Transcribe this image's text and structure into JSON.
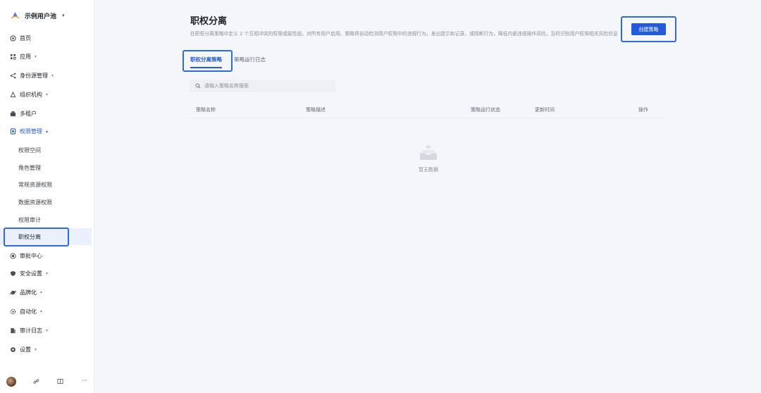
{
  "sidebar": {
    "brand": "示例用户池",
    "items": [
      {
        "label": "首页"
      },
      {
        "label": "应用"
      },
      {
        "label": "身份源管理"
      },
      {
        "label": "组织机构"
      },
      {
        "label": "多租户"
      },
      {
        "label": "权限管理"
      },
      {
        "label": "审批中心"
      },
      {
        "label": "安全设置"
      },
      {
        "label": "品牌化"
      },
      {
        "label": "自动化"
      },
      {
        "label": "审计日志"
      },
      {
        "label": "设置"
      }
    ],
    "sub_items": [
      {
        "label": "权限空间"
      },
      {
        "label": "角色管理"
      },
      {
        "label": "常规资源权限"
      },
      {
        "label": "数据资源权限"
      },
      {
        "label": "权限审计"
      },
      {
        "label": "职权分离"
      }
    ],
    "footer_more": "···"
  },
  "header": {
    "title": "职权分离",
    "description": "在职权分离策略中定义 2 个互相冲突的权限或属性组，对所有用户启用。策略将自动检测用户权限中的违规行为，发出提示和记录，或阻断行为，降低内部违规操作风险，及时识别用户权限相关风险信息",
    "create_button": "创建策略"
  },
  "tabs": [
    {
      "label": "职权分离策略",
      "active": true
    },
    {
      "label": "策略运行日志",
      "active": false
    }
  ],
  "search": {
    "placeholder": "请输入策略名称搜索",
    "value": ""
  },
  "table": {
    "columns": [
      "策略名称",
      "策略描述",
      "策略运行状态",
      "更新时间",
      "操作"
    ]
  },
  "empty": {
    "text": "暂无数据"
  },
  "colors": {
    "accent": "#245bdb",
    "highlight": "#2f6ae0"
  }
}
